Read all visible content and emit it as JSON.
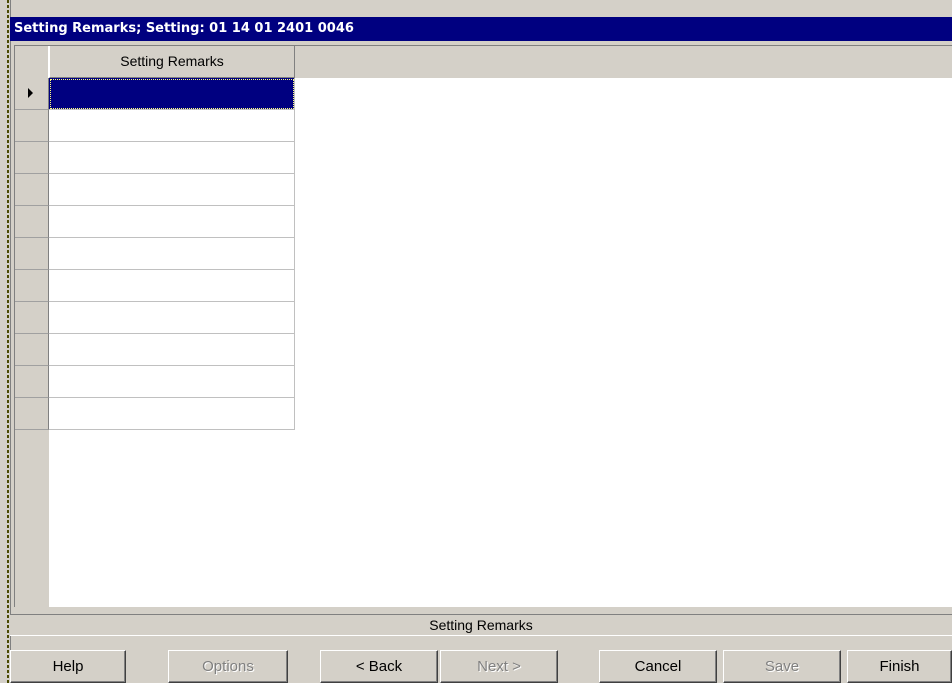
{
  "window": {
    "title": "Setting Remarks; Setting: 01 14 01 2401 0046"
  },
  "grid": {
    "column_header": "Setting Remarks",
    "rows": [
      "",
      "",
      "",
      "",
      "",
      "",
      "",
      "",
      "",
      "",
      ""
    ],
    "selected_row_index": 0,
    "selection_color": "#000080"
  },
  "status_bar": {
    "text": "Setting Remarks"
  },
  "buttons": {
    "help": "Help",
    "options": "Options",
    "back": "< Back",
    "next": "Next >",
    "cancel": "Cancel",
    "save": "Save",
    "finish": "Finish"
  },
  "colors": {
    "titlebar": "#000080",
    "face": "#d4d0c8"
  }
}
